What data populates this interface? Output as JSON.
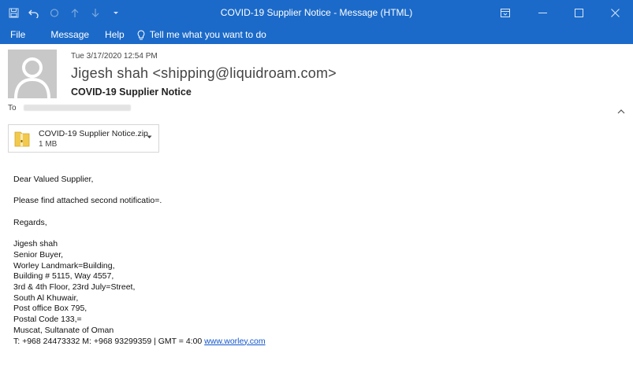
{
  "titlebar": {
    "title": "COVID-19 Supplier Notice  -  Message (HTML)",
    "qat_icons": [
      "save-icon",
      "undo-icon",
      "redo-icon",
      "arrow-up-icon",
      "arrow-down-icon",
      "customize-icon"
    ],
    "window_controls": [
      "ribbon-display-options-icon",
      "minimize-icon",
      "maximize-icon",
      "close-icon"
    ]
  },
  "ribbon": {
    "tabs": [
      "File",
      "Message",
      "Help"
    ],
    "tell_me": "Tell me what you want to do"
  },
  "header": {
    "datetime": "Tue 3/17/2020 12:54 PM",
    "from": "Jigesh shah <shipping@liquidroam.com>",
    "subject": "COVID-19 Supplier Notice",
    "to_label": "To"
  },
  "attachment": {
    "name": "COVID-19 Supplier Notice.zip",
    "size": "1 MB"
  },
  "body": {
    "greeting": "Dear Valued Supplier,",
    "line1": "Please find attached second notificatio=.",
    "regards": "Regards,",
    "signature": [
      "Jigesh shah",
      "Senior Buyer,",
      "Worley Landmark=Building,",
      "Building # 5115, Way 4557,",
      "3rd & 4th Floor, 23rd July=Street,",
      "South Al Khuwair,",
      "Post office Box 795,",
      "Postal Code 133,=",
      "Muscat, Sultanate of Oman"
    ],
    "contact": "T: +968 24473332 M: +968 93299359 | GMT = 4:00 ",
    "link": "www.worley.com"
  }
}
